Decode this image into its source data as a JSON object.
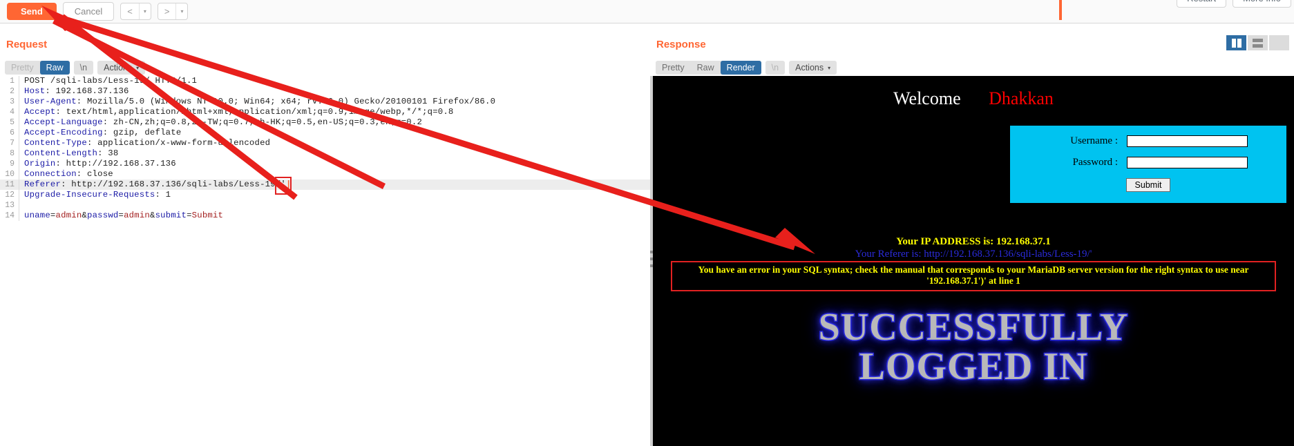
{
  "toolbar": {
    "send_label": "Send",
    "cancel_label": "Cancel",
    "prev_icon": "chevron-left-icon",
    "next_icon": "chevron-right-icon",
    "caret_glyph": "▾",
    "restart_label": "Restart",
    "more_info_label": "More Info"
  },
  "request_panel": {
    "title": "Request",
    "tabs": [
      {
        "label": "Pretty",
        "active": false,
        "dim": true
      },
      {
        "label": "Raw",
        "active": true,
        "dim": false
      },
      {
        "label": "\\n",
        "active": false,
        "dim": false
      }
    ],
    "actions_label": "Actions",
    "lines": [
      {
        "num": "1",
        "text": "POST /sqli-labs/Less-19/ HTTP/1.1"
      },
      {
        "num": "2",
        "text": "Host: 192.168.37.136"
      },
      {
        "num": "3",
        "text": "User-Agent: Mozilla/5.0 (Windows NT 10.0; Win64; x64; rv:86.0) Gecko/20100101 Firefox/86.0"
      },
      {
        "num": "4",
        "text": "Accept: text/html,application/xhtml+xml,application/xml;q=0.9,image/webp,*/*;q=0.8"
      },
      {
        "num": "5",
        "text": "Accept-Language: zh-CN,zh;q=0.8,zh-TW;q=0.7,zh-HK;q=0.5,en-US;q=0.3,en;q=0.2"
      },
      {
        "num": "6",
        "text": "Accept-Encoding: gzip, deflate"
      },
      {
        "num": "7",
        "text": "Content-Type: application/x-www-form-urlencoded"
      },
      {
        "num": "8",
        "text": "Content-Length: 38"
      },
      {
        "num": "9",
        "text": "Origin: http://192.168.37.136"
      },
      {
        "num": "10",
        "text": "Connection: close"
      },
      {
        "num": "11",
        "text": "Referer: http://192.168.37.136/sqli-labs/Less-19/'"
      },
      {
        "num": "12",
        "text": "Upgrade-Insecure-Requests: 1"
      },
      {
        "num": "13",
        "text": ""
      },
      {
        "num": "14",
        "text": "uname=admin&passwd=admin&submit=Submit"
      }
    ],
    "highlighted_line": "11",
    "caret_glyph": "|"
  },
  "response_panel": {
    "title": "Response",
    "tabs": [
      {
        "label": "Pretty",
        "active": false,
        "dim": false
      },
      {
        "label": "Raw",
        "active": false,
        "dim": false
      },
      {
        "label": "Render",
        "active": true,
        "dim": false
      },
      {
        "label": "\\n",
        "active": false,
        "dim": true
      }
    ],
    "actions_label": "Actions"
  },
  "layout_toggles": [
    {
      "name": "split-vertical-icon",
      "active": true
    },
    {
      "name": "split-horizontal-icon",
      "active": false
    },
    {
      "name": "single-pane-icon",
      "active": false
    }
  ],
  "rendered_page": {
    "welcome_text": "Welcome",
    "user_text": "Dhakkan",
    "form": {
      "username_label": "Username :",
      "username_value": "",
      "password_label": "Password :",
      "password_value": "",
      "submit_label": "Submit"
    },
    "ip_line": "Your IP ADDRESS is: 192.168.37.1",
    "referer_line": "Your Referer is: http://192.168.37.136/sqli-labs/Less-19/'",
    "sql_error": "You have an error in your SQL syntax; check the manual that corresponds to your MariaDB server version for the right syntax to use near '192.168.37.1')' at line 1",
    "success_line_1": "SUCCESSFULLY",
    "success_line_2": "LOGGED IN"
  },
  "colors": {
    "accent_orange": "#ff6633",
    "tab_active_blue": "#2e6da4",
    "annotation_red": "#e12121",
    "render_bg": "#000000",
    "form_cyan": "#00c3f0",
    "error_yellow": "#ffff00",
    "referer_blue": "#2b2bdc"
  }
}
